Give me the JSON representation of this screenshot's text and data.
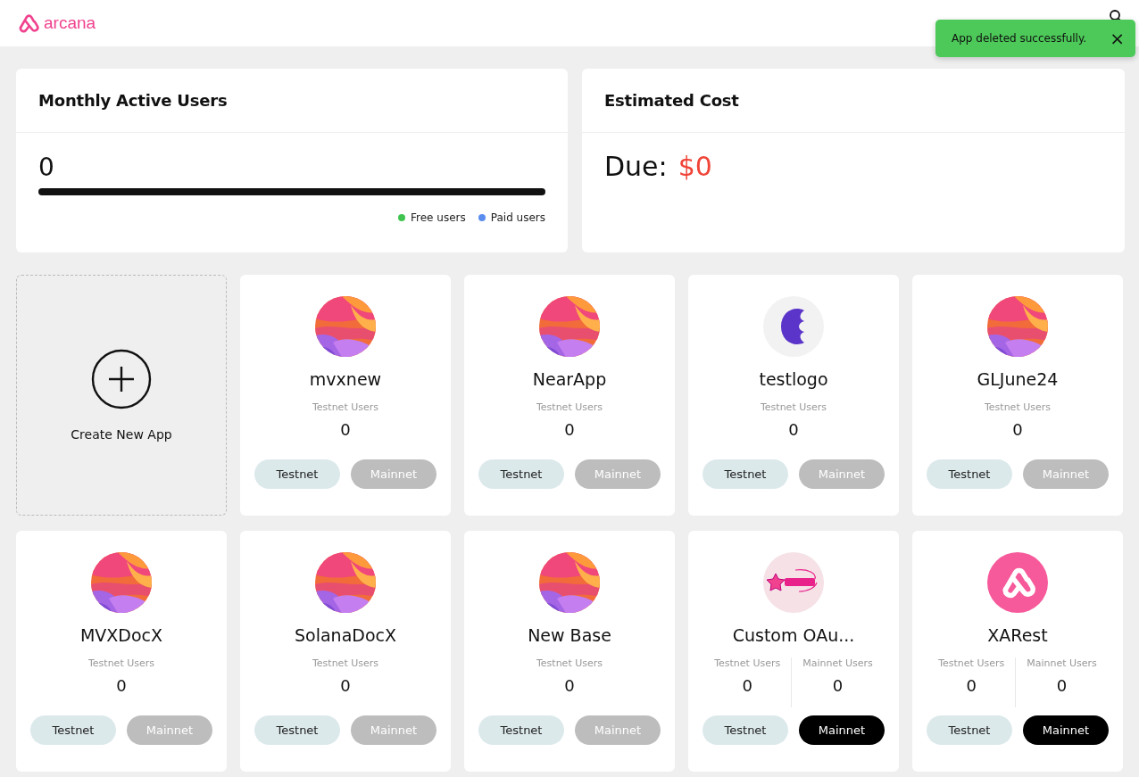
{
  "header": {
    "brand": "arcana"
  },
  "toast": {
    "message": "App deleted successfully.",
    "close": "×"
  },
  "mau_card": {
    "title": "Monthly Active Users",
    "value": "0",
    "legend": [
      {
        "label": "Free users",
        "color": "#3fc54f"
      },
      {
        "label": "Paid users",
        "color": "#5b8def"
      }
    ]
  },
  "cost_card": {
    "title": "Estimated Cost",
    "label": "Due:",
    "amount": "$0"
  },
  "create_app": {
    "label": "Create New App"
  },
  "apps": [
    {
      "name": "mvxnew",
      "kind": "gradient",
      "stats": [
        {
          "label": "Testnet Users",
          "value": "0"
        }
      ],
      "buttons": [
        {
          "label": "Testnet",
          "disabled": false
        },
        {
          "label": "Mainnet",
          "disabled": true
        }
      ]
    },
    {
      "name": "NearApp",
      "kind": "gradient",
      "stats": [
        {
          "label": "Testnet Users",
          "value": "0"
        }
      ],
      "buttons": [
        {
          "label": "Testnet",
          "disabled": false
        },
        {
          "label": "Mainnet",
          "disabled": true
        }
      ]
    },
    {
      "name": "testlogo",
      "kind": "letter",
      "stats": [
        {
          "label": "Testnet Users",
          "value": "0"
        }
      ],
      "buttons": [
        {
          "label": "Testnet",
          "disabled": false
        },
        {
          "label": "Mainnet",
          "disabled": true
        }
      ]
    },
    {
      "name": "GLJune24",
      "kind": "gradient",
      "stats": [
        {
          "label": "Testnet Users",
          "value": "0"
        }
      ],
      "buttons": [
        {
          "label": "Testnet",
          "disabled": false
        },
        {
          "label": "Mainnet",
          "disabled": true
        }
      ]
    },
    {
      "name": "MVXDocX",
      "kind": "gradient",
      "stats": [
        {
          "label": "Testnet Users",
          "value": "0"
        }
      ],
      "buttons": [
        {
          "label": "Testnet",
          "disabled": false
        },
        {
          "label": "Mainnet",
          "disabled": true
        }
      ]
    },
    {
      "name": "SolanaDocX",
      "kind": "gradient",
      "stats": [
        {
          "label": "Testnet Users",
          "value": "0"
        }
      ],
      "buttons": [
        {
          "label": "Testnet",
          "disabled": false
        },
        {
          "label": "Mainnet",
          "disabled": true
        }
      ]
    },
    {
      "name": "New Base",
      "kind": "gradient",
      "stats": [
        {
          "label": "Testnet Users",
          "value": "0"
        }
      ],
      "buttons": [
        {
          "label": "Testnet",
          "disabled": false
        },
        {
          "label": "Mainnet",
          "disabled": true
        }
      ]
    },
    {
      "name": "Custom OAu...",
      "kind": "star",
      "stats": [
        {
          "label": "Testnet Users",
          "value": "0"
        },
        {
          "label": "Mainnet Users",
          "value": "0"
        }
      ],
      "buttons": [
        {
          "label": "Testnet",
          "disabled": false
        },
        {
          "label": "Mainnet",
          "disabled": false
        }
      ]
    },
    {
      "name": "XARest",
      "kind": "brand",
      "stats": [
        {
          "label": "Testnet Users",
          "value": "0"
        },
        {
          "label": "Mainnet Users",
          "value": "0"
        }
      ],
      "buttons": [
        {
          "label": "Testnet",
          "disabled": false
        },
        {
          "label": "Mainnet",
          "disabled": false
        }
      ]
    }
  ]
}
